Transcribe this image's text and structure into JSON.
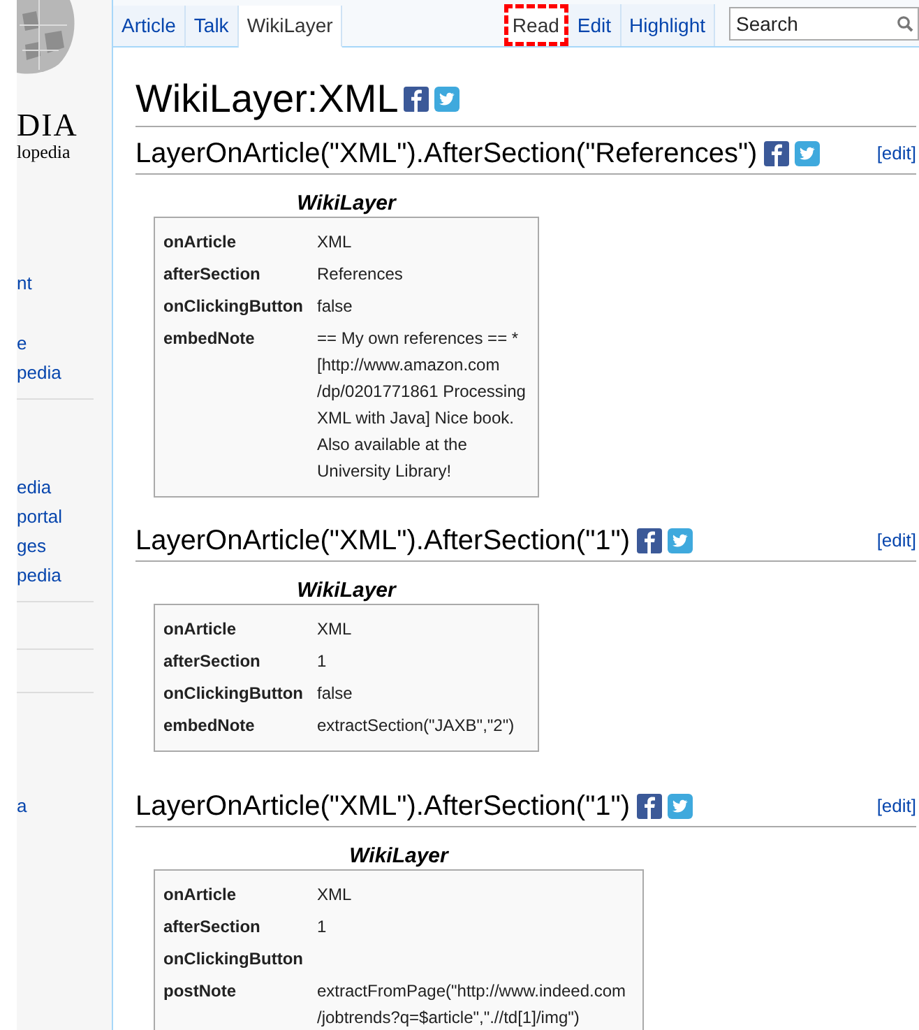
{
  "sidebar": {
    "logo_text": "DIA",
    "logo_subtitle": "lopedia",
    "groups": [
      {
        "links": [
          "nt"
        ]
      },
      {
        "links": [
          "e",
          "pedia"
        ]
      },
      {
        "links": [
          "edia",
          "portal",
          "ges",
          "pedia"
        ]
      },
      {
        "links": [
          "a"
        ]
      }
    ]
  },
  "tabs": [
    {
      "label": "Article",
      "selected": false
    },
    {
      "label": "Talk",
      "selected": false
    },
    {
      "label": "WikiLayer",
      "selected": true
    }
  ],
  "view_tabs": [
    {
      "label": "Read",
      "selected": true,
      "annotated": true
    },
    {
      "label": "Edit",
      "selected": false,
      "annotated": false
    },
    {
      "label": "Highlight",
      "selected": false,
      "annotated": false
    }
  ],
  "search": {
    "placeholder": "Search"
  },
  "title": "WikiLayer:XML",
  "sections": [
    {
      "heading": "LayerOnArticle(\"XML\").AfterSection(\"References\")",
      "edit_link": "[edit]",
      "table": {
        "caption": "WikiLayer",
        "wide": false,
        "rows": [
          {
            "label": "onArticle",
            "value": "XML"
          },
          {
            "label": "afterSection",
            "value": "References"
          },
          {
            "label": "onClickingButton",
            "value": "false"
          },
          {
            "label": "embedNote",
            "value": "== My own references == * [http://www.amazon.com /dp/0201771861 Processing XML with Java] Nice book. Also available at the University Library!"
          }
        ]
      }
    },
    {
      "heading": "LayerOnArticle(\"XML\").AfterSection(\"1\")",
      "edit_link": "[edit]",
      "table": {
        "caption": "WikiLayer",
        "wide": false,
        "rows": [
          {
            "label": "onArticle",
            "value": "XML"
          },
          {
            "label": "afterSection",
            "value": "1"
          },
          {
            "label": "onClickingButton",
            "value": "false"
          },
          {
            "label": "embedNote",
            "value": "extractSection(\"JAXB\",\"2\")"
          }
        ]
      }
    },
    {
      "heading": "LayerOnArticle(\"XML\").AfterSection(\"1\")",
      "edit_link": "[edit]",
      "table": {
        "caption": "WikiLayer",
        "wide": true,
        "rows": [
          {
            "label": "onArticle",
            "value": "XML"
          },
          {
            "label": "afterSection",
            "value": "1"
          },
          {
            "label": "onClickingButton"
          },
          {
            "label": "postNote",
            "value": "extractFromPage(\"http://www.indeed.com /jobtrends?q=$article\",\".//td[1]/img\")"
          }
        ]
      }
    }
  ]
}
